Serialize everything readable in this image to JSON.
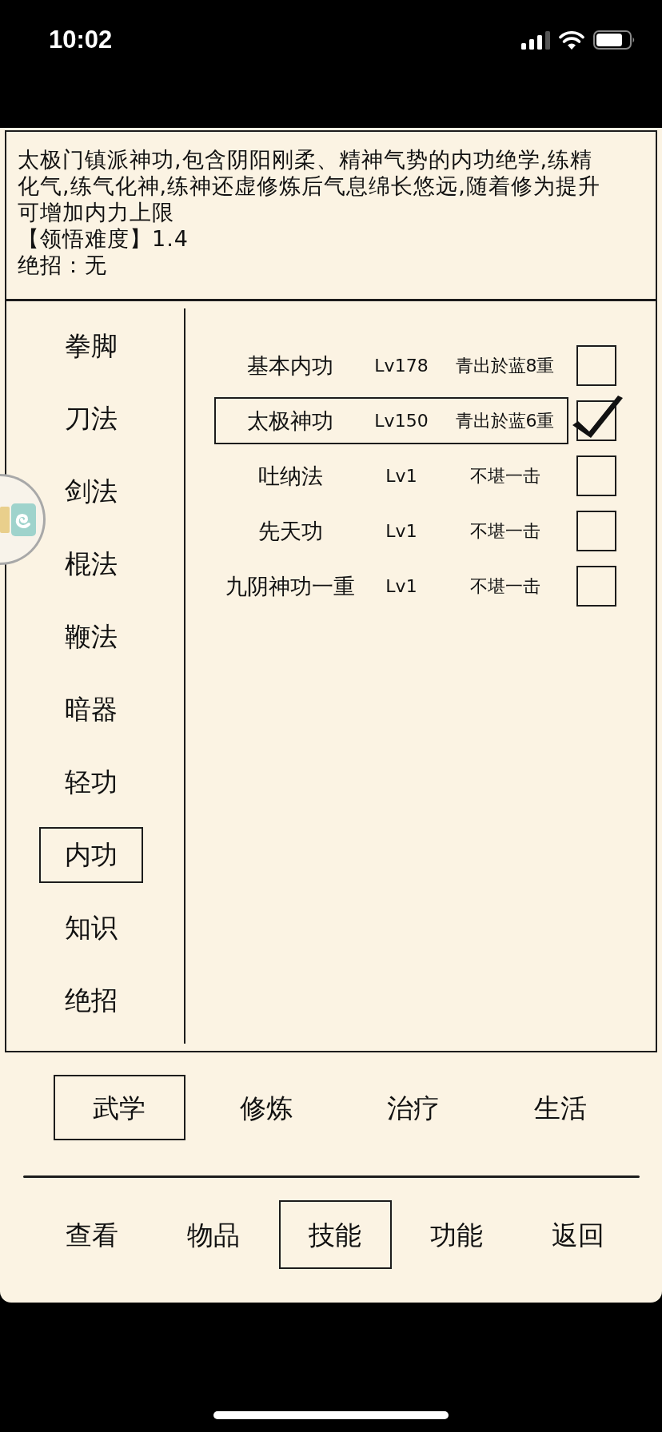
{
  "status_bar": {
    "time": "10:02"
  },
  "description": {
    "text": "太极门镇派神功,包含阴阳刚柔、精神气势的内功绝学,练精化气,练气化神,练神还虚修炼后气息绵长悠远,随着修为提升可增加内力上限",
    "difficulty": "【领悟难度】1.4",
    "special_move": "绝招：无"
  },
  "categories": [
    {
      "label": "拳脚",
      "selected": false
    },
    {
      "label": "刀法",
      "selected": false
    },
    {
      "label": "剑法",
      "selected": false
    },
    {
      "label": "棍法",
      "selected": false
    },
    {
      "label": "鞭法",
      "selected": false
    },
    {
      "label": "暗器",
      "selected": false
    },
    {
      "label": "轻功",
      "selected": false
    },
    {
      "label": "内功",
      "selected": true
    },
    {
      "label": "知识",
      "selected": false
    },
    {
      "label": "绝招",
      "selected": false
    }
  ],
  "skills": [
    {
      "name": "基本内功",
      "level": "Lv178",
      "grade": "青出於蓝8重",
      "selected": false,
      "checked": false
    },
    {
      "name": "太极神功",
      "level": "Lv150",
      "grade": "青出於蓝6重",
      "selected": true,
      "checked": true
    },
    {
      "name": "吐纳法",
      "level": "Lv1",
      "grade": "不堪一击",
      "selected": false,
      "checked": false
    },
    {
      "name": "先天功",
      "level": "Lv1",
      "grade": "不堪一击",
      "selected": false,
      "checked": false
    },
    {
      "name": "九阴神功一重",
      "level": "Lv1",
      "grade": "不堪一击",
      "selected": false,
      "checked": false
    }
  ],
  "tabs": [
    {
      "label": "武学",
      "selected": true
    },
    {
      "label": "修炼",
      "selected": false
    },
    {
      "label": "治疗",
      "selected": false
    },
    {
      "label": "生活",
      "selected": false
    }
  ],
  "nav": [
    {
      "label": "查看",
      "selected": false
    },
    {
      "label": "物品",
      "selected": false
    },
    {
      "label": "技能",
      "selected": true
    },
    {
      "label": "功能",
      "selected": false
    },
    {
      "label": "返回",
      "selected": false
    }
  ]
}
